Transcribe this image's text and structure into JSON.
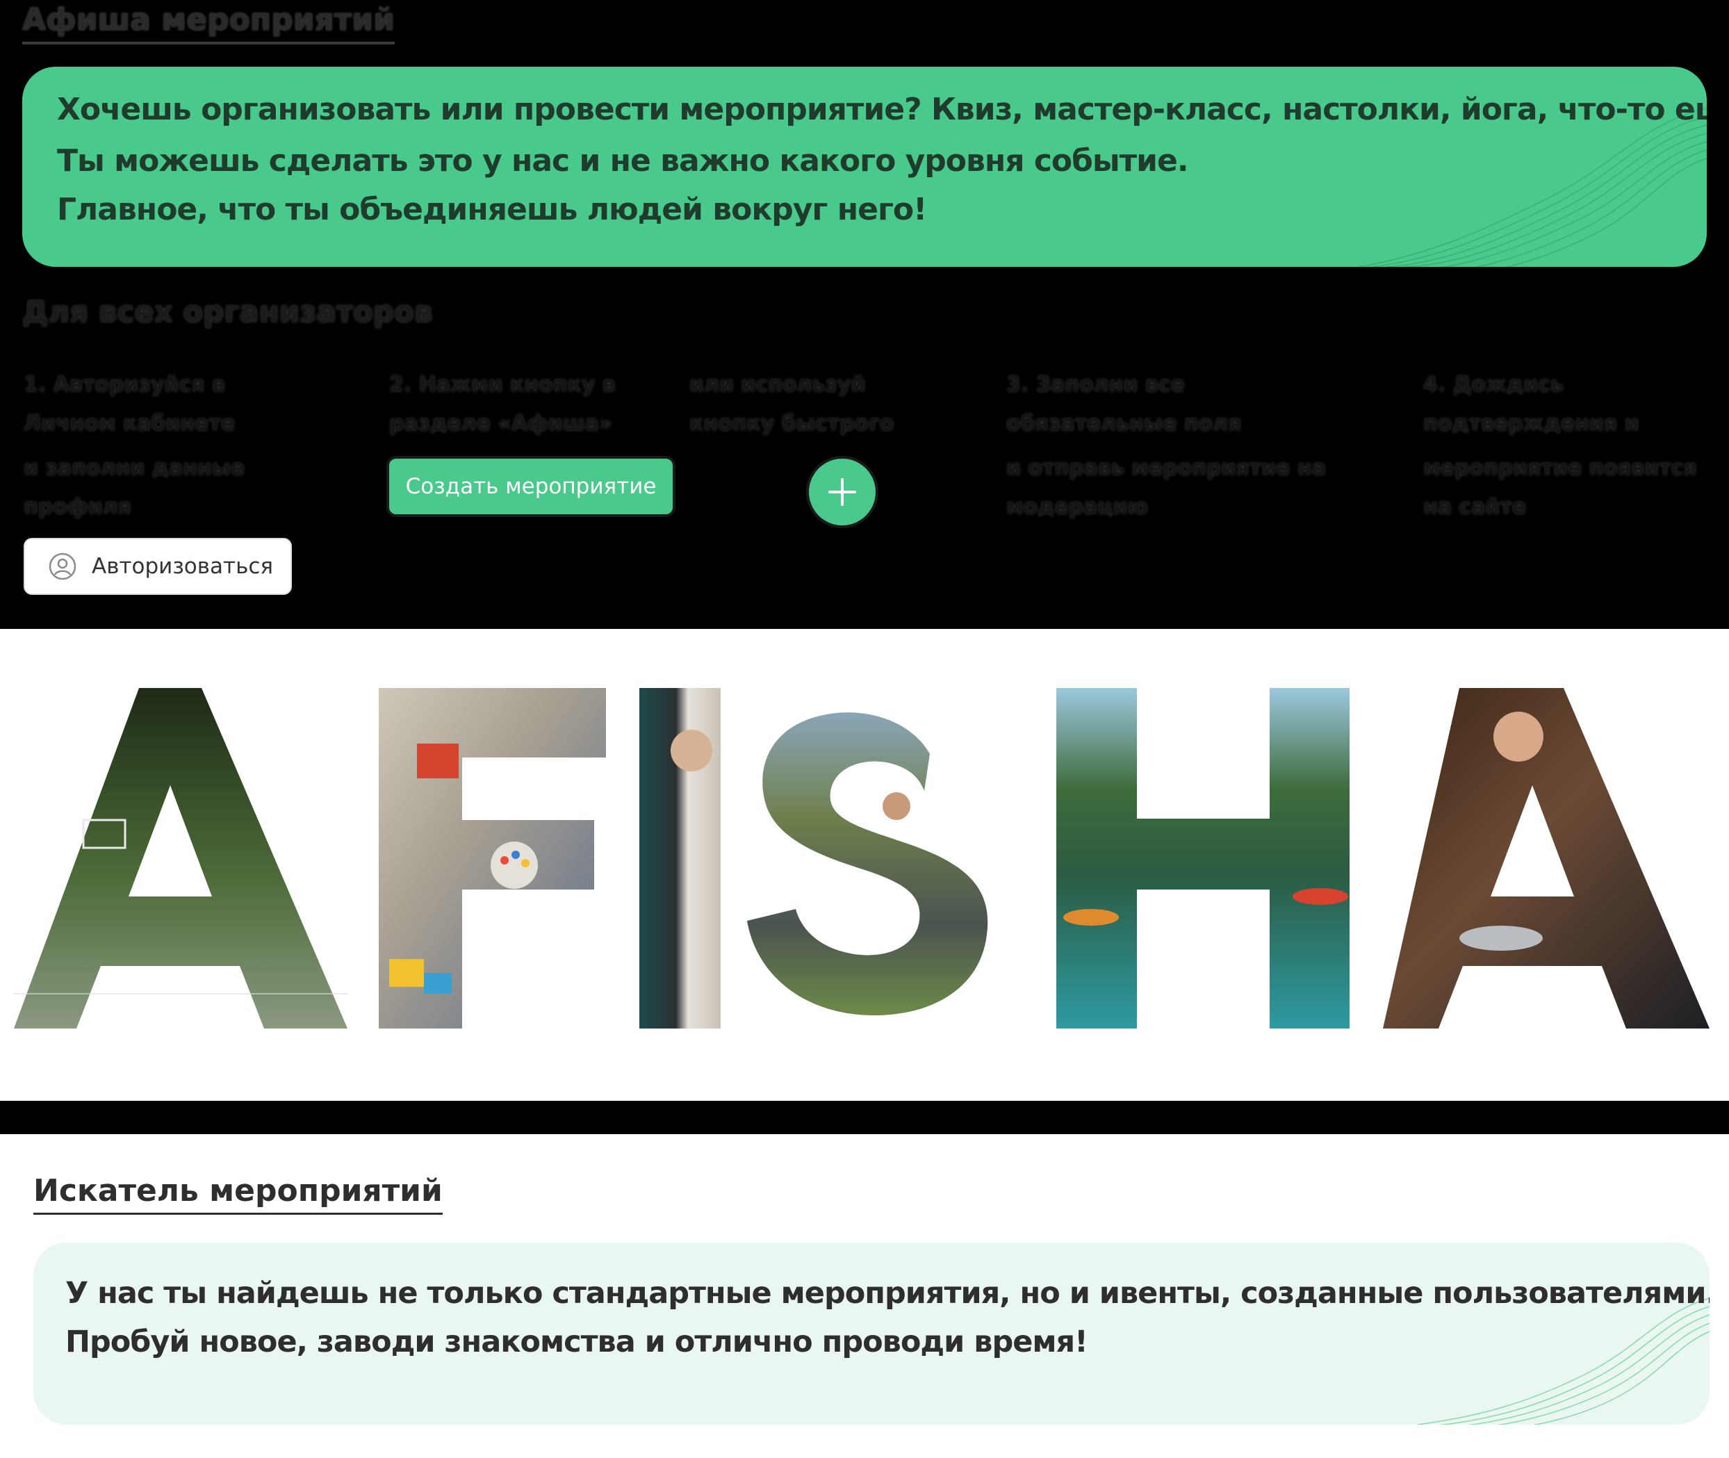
{
  "organizer": {
    "title": "Афиша мероприятий",
    "card_lines": [
      "Хочешь организовать или провести мероприятие? Квиз, мастер-класс, настолки, йога, что-то ещё?",
      "Ты можешь сделать это у нас и не важно какого уровня событие.",
      "Главное, что ты объединяешь людей вокруг него!"
    ],
    "how_title": "Для всех организаторов",
    "steps": [
      [
        "1. Авторизуйся в",
        "Личном кабинете",
        "и заполни данные",
        "профиля"
      ],
      [
        "2. Нажми кнопку в",
        "разделе «Афиша»"
      ],
      [
        "или используй",
        "кнопку быстрого"
      ],
      [
        "3. Заполни все",
        "обязательные поля",
        "и отправь мероприятие на",
        "модерацию"
      ],
      [
        "4. Дождись",
        "подтверждения и",
        "мероприятие появится",
        "на сайте"
      ]
    ],
    "create_button": "Создать мероприятие",
    "plus_icon": "plus-icon",
    "auth_button": "Авторизоваться",
    "auth_icon": "user-circle-icon"
  },
  "afisha": {
    "letters": [
      "A",
      "F",
      "I",
      "S",
      "H",
      "A"
    ]
  },
  "seeker": {
    "title": "Искатель мероприятий",
    "card_lines": [
      "У нас ты найдешь не только стандартные мероприятия, но и ивенты, созданные пользователями.",
      "Пробуй новое, заводи знакомства и отлично проводи время!"
    ]
  },
  "colors": {
    "accent": "#49c98b",
    "card_light": "#eaf7f0",
    "text_dark": "#2e2e2e"
  }
}
